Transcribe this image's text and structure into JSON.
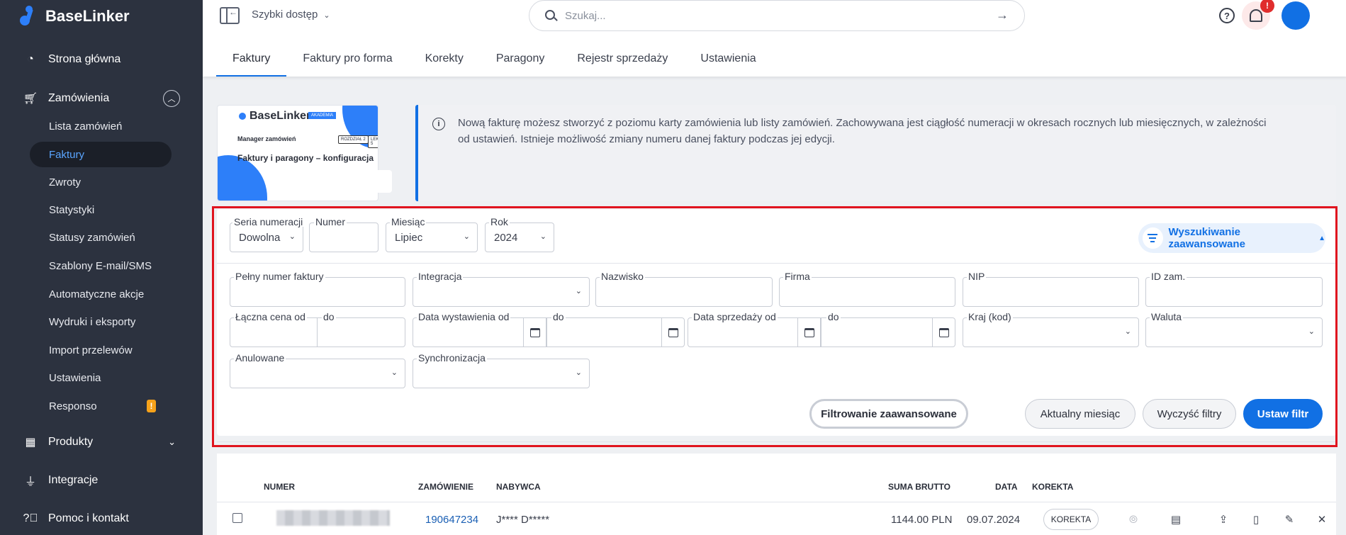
{
  "app": {
    "name": "BaseLinker"
  },
  "sidebar": {
    "main_items": [
      {
        "label": "Strona główna",
        "icon": "dashboard-icon"
      },
      {
        "label": "Zamówienia",
        "icon": "cart-icon"
      },
      {
        "label": "Produkty",
        "icon": "warehouse-icon"
      },
      {
        "label": "Integracje",
        "icon": "plug-icon"
      },
      {
        "label": "Pomoc i kontakt",
        "icon": "help-icon"
      }
    ],
    "sub_items": [
      {
        "label": "Lista zamówień"
      },
      {
        "label": "Faktury",
        "active": true
      },
      {
        "label": "Zwroty"
      },
      {
        "label": "Statystyki"
      },
      {
        "label": "Statusy zamówień"
      },
      {
        "label": "Szablony E-mail/SMS"
      },
      {
        "label": "Automatyczne akcje"
      },
      {
        "label": "Wydruki i eksporty"
      },
      {
        "label": "Import przelewów"
      },
      {
        "label": "Ustawienia"
      },
      {
        "label": "Responso",
        "badge": "!"
      }
    ],
    "badge_color": "#f6a21a",
    "active_color": "#5aa5ff"
  },
  "topbar": {
    "quick_access": "Szybki dostęp",
    "search_placeholder": "Szukaj...",
    "notification_badge": "!",
    "tabs": [
      {
        "label": "Faktury",
        "active": true
      },
      {
        "label": "Faktury pro forma"
      },
      {
        "label": "Korekty"
      },
      {
        "label": "Paragony"
      },
      {
        "label": "Rejestr sprzedaży"
      },
      {
        "label": "Ustawienia"
      }
    ]
  },
  "promo": {
    "logo": "BaseLinker",
    "academy": "AKADEMIA",
    "subtitle": "Manager zamówień",
    "tag1": "ROZDZIAŁ 2",
    "tag2": "LEKCJA 5",
    "title": "Faktury i paragony – konfiguracja"
  },
  "info": {
    "text": "Nową fakturę możesz stworzyć z poziomu karty zamówienia lub listy zamówień. Zachowywana jest ciągłość numeracji w okresach rocznych lub miesięcznych, w zależności od ustawień. Istnieje możliwość zmiany numeru danej faktury podczas jej edycji."
  },
  "filters": {
    "seria_label": "Seria numeracji",
    "seria_value": "Dowolna",
    "numer_label": "Numer",
    "numer_value": "",
    "miesiac_label": "Miesiąc",
    "miesiac_value": "Lipiec",
    "rok_label": "Rok",
    "rok_value": "2024",
    "advanced_search": "Wyszukiwanie zaawansowane",
    "pelny_numer": "Pełny numer faktury",
    "integracja": "Integracja",
    "nazwisko": "Nazwisko",
    "firma": "Firma",
    "nip": "NIP",
    "id_zam": "ID zam.",
    "cena_od": "Łączna cena od",
    "cena_do": "do",
    "data_wyst_od": "Data wystawienia od",
    "data_wyst_do": "do",
    "data_sprz_od": "Data sprzedaży od",
    "data_sprz_do": "do",
    "kraj": "Kraj (kod)",
    "waluta": "Waluta",
    "anulowane": "Anulowane",
    "synchronizacja": "Synchronizacja",
    "btn_advanced": "Filtrowanie zaawansowane",
    "btn_current_month": "Aktualny miesiąc",
    "btn_clear": "Wyczyść filtry",
    "btn_apply": "Ustaw filtr"
  },
  "table": {
    "headers": {
      "numer": "Numer",
      "zamowienie": "Zamówienie",
      "nabywca": "Nabywca",
      "suma": "Suma brutto",
      "data": "Data",
      "korekta": "Korekta"
    },
    "rows": [
      {
        "zamowienie": "190647234",
        "nabywca": "J**** D*****",
        "suma": "1144.00 PLN",
        "data": "09.07.2024",
        "korekta": "KOREKTA"
      }
    ]
  },
  "colors": {
    "accent": "#1170e4",
    "sidebar_bg": "#2c323f",
    "highlight_frame": "#e0141e"
  }
}
